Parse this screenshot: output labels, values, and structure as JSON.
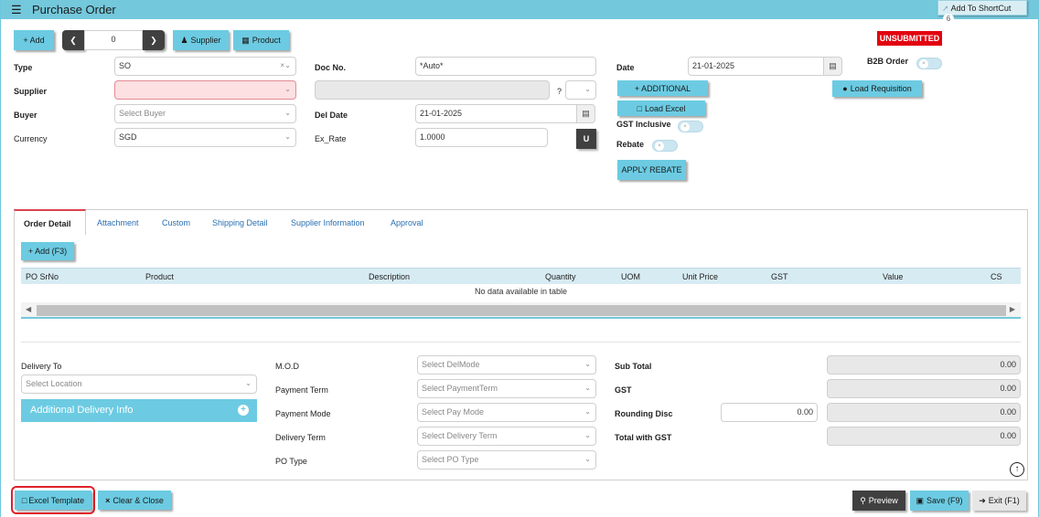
{
  "window": {
    "title": "Purchase Order",
    "shortcut_label": "Add To ShortCut",
    "shortcut_count": "6",
    "status": "UNSUBMITTED"
  },
  "toolbar": {
    "add_label": "+ Add",
    "record_number": "0",
    "supplier_label": "Supplier",
    "product_label": "Product"
  },
  "header": {
    "type": {
      "label": "Type",
      "value": "SO"
    },
    "supplier": {
      "label": "Supplier",
      "value": ""
    },
    "buyer": {
      "label": "Buyer",
      "placeholder": "Select Buyer"
    },
    "currency": {
      "label": "Currency",
      "value": "SGD"
    },
    "doc_no": {
      "label": "Doc No.",
      "value": "*Auto*"
    },
    "supplier_question": "?",
    "del_date": {
      "label": "Del Date",
      "value": "21-01-2025"
    },
    "ex_rate": {
      "label": "Ex_Rate",
      "value": "1.0000"
    },
    "u_label": "U",
    "date": {
      "label": "Date",
      "value": "21-01-2025"
    },
    "b2b_label": "B2B Order",
    "additional_label": "+ ADDITIONAL",
    "load_requisition_label": "Load Requisition",
    "load_excel_label": "Load Excel",
    "gst_inclusive_label": "GST Inclusive",
    "rebate_label": "Rebate",
    "apply_rebate_label": "APPLY REBATE"
  },
  "tabs": [
    "Order Detail",
    "Attachment",
    "Custom",
    "Shipping Detail",
    "Supplier Information",
    "Approval"
  ],
  "grid": {
    "add_label": "+ Add (F3)",
    "columns": [
      "PO SrNo",
      "Product",
      "Description",
      "Quantity",
      "UOM",
      "Unit Price",
      "GST",
      "Value",
      "CS"
    ],
    "empty_text": "No data available in table"
  },
  "footer": {
    "delivery_to_label": "Delivery To",
    "location_placeholder": "Select Location",
    "additional_delivery_label": "Additional Delivery Info",
    "mod_label": "M.O.D",
    "mod_placeholder": "Select DelMode",
    "payment_term_label": "Payment Term",
    "payment_term_placeholder": "Select PaymentTerm",
    "payment_mode_label": "Payment Mode",
    "payment_mode_placeholder": "Select Pay Mode",
    "delivery_term_label": "Delivery Term",
    "delivery_term_placeholder": "Select Delivery Term",
    "po_type_label": "PO Type",
    "po_type_placeholder": "Select PO Type",
    "sub_total_label": "Sub Total",
    "sub_total_value": "0.00",
    "gst_label": "GST",
    "gst_value": "0.00",
    "rounding_label": "Rounding Disc",
    "rounding_input": "0.00",
    "rounding_value": "0.00",
    "total_label": "Total with GST",
    "total_value": "0.00"
  },
  "actions": {
    "excel_template": "Excel Template",
    "clear_close": "Clear & Close",
    "preview": "Preview",
    "save": "Save (F9)",
    "exit": "Exit (F1)"
  }
}
